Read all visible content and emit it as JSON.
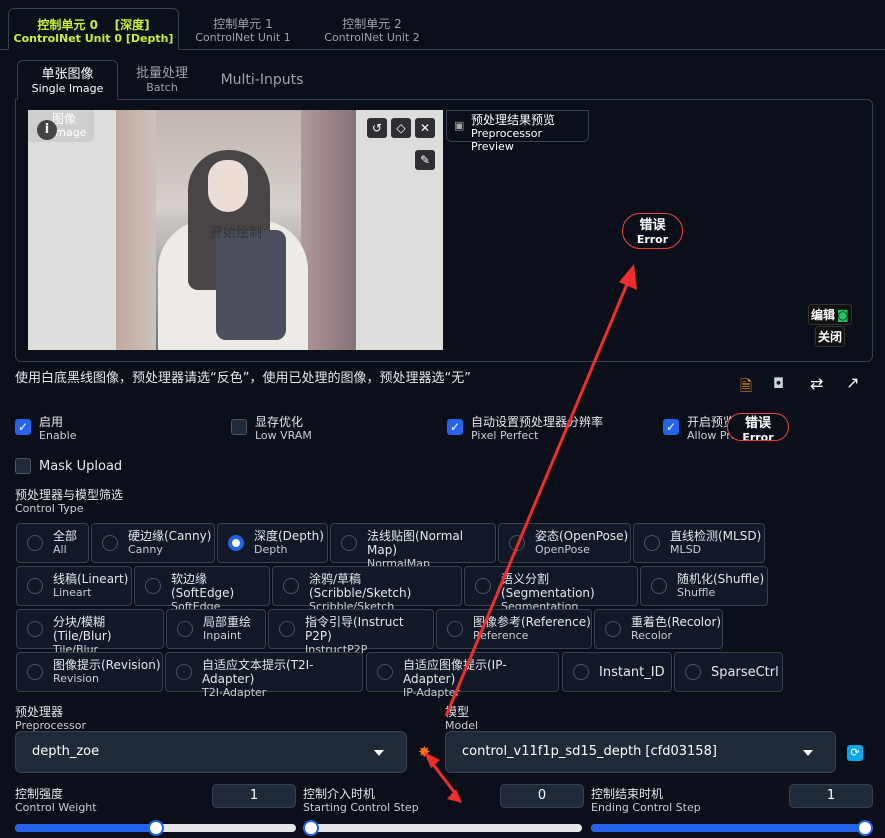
{
  "unit_tabs": [
    {
      "cn": "控制单元 0    [深度]",
      "en": "ControlNet Unit 0 [Depth]"
    },
    {
      "cn": "控制单元 1",
      "en": "ControlNet Unit 1"
    },
    {
      "cn": "控制单元 2",
      "en": "ControlNet Unit 2"
    }
  ],
  "input_tabs": [
    {
      "cn": "单张图像",
      "en": "Single Image"
    },
    {
      "cn": "批量处理",
      "en": "Batch"
    },
    {
      "cn": "Multi-Inputs",
      "en": ""
    }
  ],
  "image_area": {
    "label_cn": "图像",
    "label_en": "Image",
    "start_drawing": "开始绘制",
    "preview_cn": "预处理结果预览",
    "preview_en": "Preprocessor Preview",
    "error_cn": "错误",
    "error_en": "Error",
    "edit_label": "编辑",
    "close_label": "关闭"
  },
  "hint": "使用白底黑线图像，预处理器请选“反色”，使用已处理的图像，预处理器选“无”",
  "options": {
    "enable": {
      "cn": "启用",
      "en": "Enable",
      "checked": true
    },
    "low_vram": {
      "cn": "显存优化",
      "en": "Low VRAM",
      "checked": false
    },
    "pixel_perfect": {
      "cn": "自动设置预处理器分辨率",
      "en": "Pixel Perfect",
      "checked": true
    },
    "allow_preview": {
      "cn": "开启预览",
      "en": "Allow Preview",
      "checked": true
    },
    "mask_upload": {
      "label": "Mask Upload",
      "checked": false
    }
  },
  "control_type": {
    "title_cn": "预处理器与模型筛选",
    "title_en": "Control Type",
    "items": [
      {
        "cn": "全部",
        "en": "All"
      },
      {
        "cn": "硬边缘(Canny)",
        "en": "Canny"
      },
      {
        "cn": "深度(Depth)",
        "en": "Depth",
        "selected": true
      },
      {
        "cn": "法线贴图(Normal Map)",
        "en": "NormalMap"
      },
      {
        "cn": "姿态(OpenPose)",
        "en": "OpenPose"
      },
      {
        "cn": "直线检测(MLSD)",
        "en": "MLSD"
      },
      {
        "cn": "线稿(Lineart)",
        "en": "Lineart"
      },
      {
        "cn": "软边缘(SoftEdge)",
        "en": "SoftEdge"
      },
      {
        "cn": "涂鸦/草稿(Scribble/Sketch)",
        "en": "Scribble/Sketch"
      },
      {
        "cn": "语义分割(Segmentation)",
        "en": "Segmentation"
      },
      {
        "cn": "随机化(Shuffle)",
        "en": "Shuffle"
      },
      {
        "cn": "分块/模糊(Tile/Blur)",
        "en": "Tile/Blur"
      },
      {
        "cn": "局部重绘",
        "en": "Inpaint"
      },
      {
        "cn": "指令引导(Instruct P2P)",
        "en": "InstructP2P"
      },
      {
        "cn": "图像参考(Reference)",
        "en": "Reference"
      },
      {
        "cn": "重着色(Recolor)",
        "en": "Recolor"
      },
      {
        "cn": "图像提示(Revision)",
        "en": "Revision"
      },
      {
        "cn": "自适应文本提示(T2I-Adapter)",
        "en": "T2I-Adapter"
      },
      {
        "cn": "自适应图像提示(IP-Adapter)",
        "en": "IP-Adapter"
      },
      {
        "cn": "Instant_ID",
        "en": ""
      },
      {
        "cn": "SparseCtrl",
        "en": ""
      }
    ]
  },
  "preprocessor": {
    "label_cn": "预处理器",
    "label_en": "Preprocessor",
    "value": "depth_zoe"
  },
  "model": {
    "label_cn": "模型",
    "label_en": "Model",
    "value": "control_v11f1p_sd15_depth [cfd03158]"
  },
  "sliders": [
    {
      "cn": "控制强度",
      "en": "Control Weight",
      "value": "1",
      "fraction": 0.5
    },
    {
      "cn": "控制介入时机",
      "en": "Starting Control Step",
      "value": "0",
      "fraction": 0.0
    },
    {
      "cn": "控制结束时机",
      "en": "Ending Control Step",
      "value": "1",
      "fraction": 1.0
    }
  ],
  "icons": {
    "accent": "#2563eb",
    "error_color": "#ef4444",
    "active_tab_color": "#c6f432"
  }
}
